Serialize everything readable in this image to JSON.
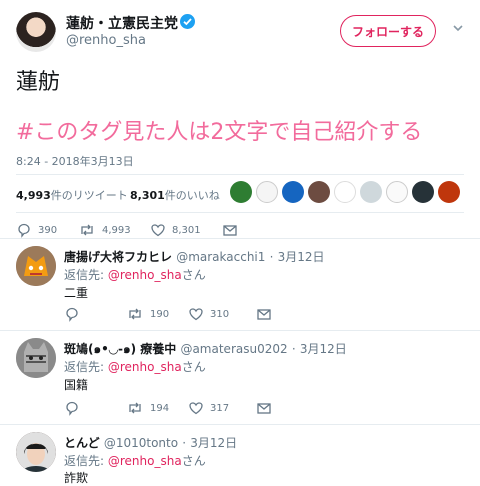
{
  "tweet": {
    "author_name": "蓮舫・立憲民主党",
    "author_handle": "@renho_sha",
    "follow_label": "フォローする",
    "text": "蓮舫",
    "hashtag": "#このタグ見た人は2文字で自己紹介する",
    "timestamp": "8:24 - 2018年3月13日",
    "retweets_count": "4,993",
    "retweets_label": "件のリツイート",
    "likes_count": "8,301",
    "likes_label": "件のいいね",
    "actions": {
      "reply": "390",
      "retweet": "4,993",
      "like": "8,301"
    }
  },
  "replies": [
    {
      "name": "唐揚げ大将フカヒレ",
      "handle": "@marakacchi1",
      "sep": "·",
      "date": "3月12日",
      "reply_prefix": "返信先:",
      "reply_to": "@renho_sha",
      "reply_suffix": "さん",
      "text": "二重",
      "actions": {
        "reply": "",
        "retweet": "190",
        "like": "310"
      }
    },
    {
      "name": "斑鳩(๑•◡-๑) 療養中",
      "handle": "@amaterasu0202",
      "sep": "·",
      "date": "3月12日",
      "reply_prefix": "返信先:",
      "reply_to": "@renho_sha",
      "reply_suffix": "さん",
      "text": "国籍",
      "actions": {
        "reply": "",
        "retweet": "194",
        "like": "317"
      }
    },
    {
      "name": "とんど",
      "handle": "@1010tonto",
      "sep": "·",
      "date": "3月12日",
      "reply_prefix": "返信先:",
      "reply_to": "@renho_sha",
      "reply_suffix": "さん",
      "text": "詐欺"
    }
  ],
  "colors": {
    "accent": "#e0245e",
    "hashtag": "#f26b9c",
    "verified": "#1da1f2",
    "muted": "#657786"
  }
}
